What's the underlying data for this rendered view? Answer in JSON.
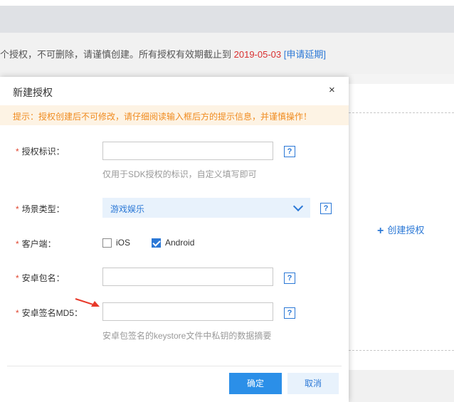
{
  "background": {
    "notice_prefix": "个授权，不可删除，请谨慎创建。所有授权有效期截止到",
    "notice_date": "2019-05-03",
    "notice_link": "[申请延期]",
    "create_auth_label": "创建授权",
    "create_auth_icon": "plus-icon"
  },
  "dialog": {
    "title": "新建授权",
    "close_glyph": "×",
    "tip": "提示：授权创建后不可修改，请仔细阅读输入框后方的提示信息，并谨慎操作！",
    "required_mark": "*",
    "help_glyph": "?",
    "fields": {
      "auth_id": {
        "label": "授权标识：",
        "value": "",
        "hint": "仅用于SDK授权的标识，自定义填写即可"
      },
      "scene_type": {
        "label": "场景类型：",
        "selected": "游戏娱乐"
      },
      "client": {
        "label": "客户端：",
        "options": [
          {
            "label": "iOS",
            "checked": false
          },
          {
            "label": "Android",
            "checked": true
          }
        ]
      },
      "package_name": {
        "label": "安卓包名：",
        "value": ""
      },
      "signature_md5": {
        "label": "安卓签名MD5：",
        "value": "",
        "hint": "安卓包签名的keystore文件中私钥的数据摘要"
      }
    },
    "buttons": {
      "confirm": "确定",
      "cancel": "取消"
    }
  },
  "colors": {
    "accent": "#2b78d6",
    "primary_button": "#2b8fe8",
    "warning_text": "#f08b1f",
    "required": "#e0452f",
    "annotation_arrow": "#e8392a"
  }
}
